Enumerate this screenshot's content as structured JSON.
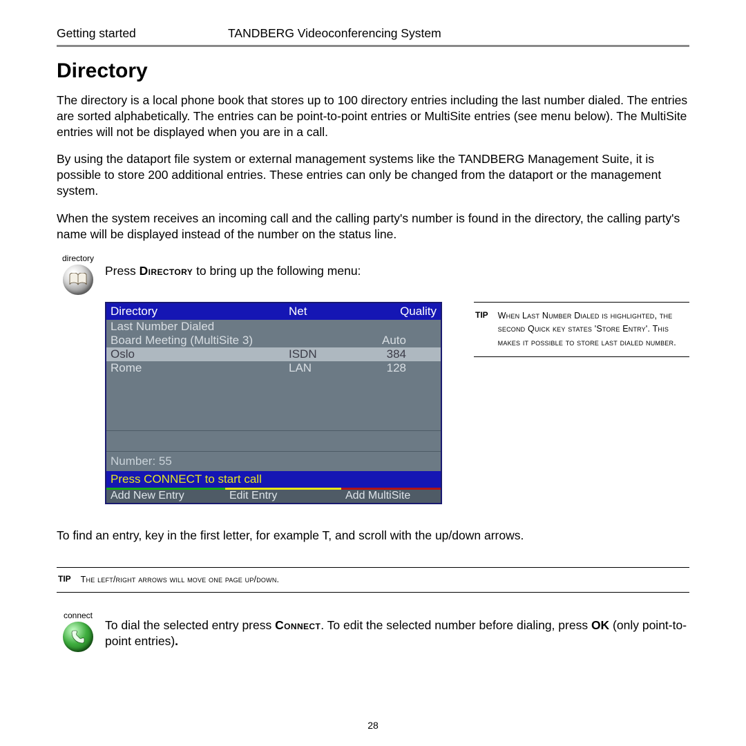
{
  "header": {
    "left": "Getting started",
    "center": "TANDBERG Videoconferencing System"
  },
  "title": "Directory",
  "para1": "The directory is a local phone book that stores up to 100 directory entries including the last number dialed. The entries are sorted alphabetically. The entries can be point-to-point entries or MultiSite entries (see menu below). The MultiSite entries will not be displayed when you are in a call.",
  "para2": "By using the dataport file system or external management systems like the TANDBERG Management Suite, it is possible to store 200 additional entries. These entries can only be changed from the dataport or the management system.",
  "para3": "When the system receives an incoming call and the calling party's number is found in the directory, the calling party's name will be displayed instead of the number on the status line.",
  "directory_icon_label": "directory",
  "press_line_a": "Press ",
  "press_line_dir": "Directory",
  "press_line_b": " to bring up the following menu:",
  "screenshot": {
    "header": {
      "name": "Directory",
      "net": "Net",
      "quality": "Quality"
    },
    "rows": [
      {
        "name": "Last Number Dialed",
        "net": "",
        "quality": "",
        "selected": false
      },
      {
        "name": "Board Meeting (MultiSite 3)",
        "net": "",
        "quality": "Auto",
        "selected": false
      },
      {
        "name": "Oslo",
        "net": "ISDN",
        "quality": "384",
        "selected": true
      },
      {
        "name": "Rome",
        "net": "LAN",
        "quality": "128",
        "selected": false
      }
    ],
    "number_label": "Number: 55",
    "connect_prompt": "Press CONNECT to start call",
    "buttons": {
      "add_new": "Add New Entry",
      "edit": "Edit Entry",
      "add_ms": "Add MultiSite"
    }
  },
  "tip1": {
    "label": "TIP",
    "text": "When Last Number Dialed is highlighted, the second Quick key states 'Store Entry'. This makes it possible to store last dialed number."
  },
  "find_entry": "To find an entry, key in the first letter, for example T, and scroll with the up/down arrows.",
  "tip2": {
    "label": "TIP",
    "text": "The left/right arrows will move one page up/down."
  },
  "connect_icon_label": "connect",
  "connect_para_a": "To dial the selected entry press ",
  "connect_word": "Connect",
  "connect_para_b": ". To edit the selected number before dialing, press ",
  "ok_word": "OK",
  "connect_para_c": " (only point-to-point entries)",
  "connect_para_d": ".",
  "page_number": "28"
}
